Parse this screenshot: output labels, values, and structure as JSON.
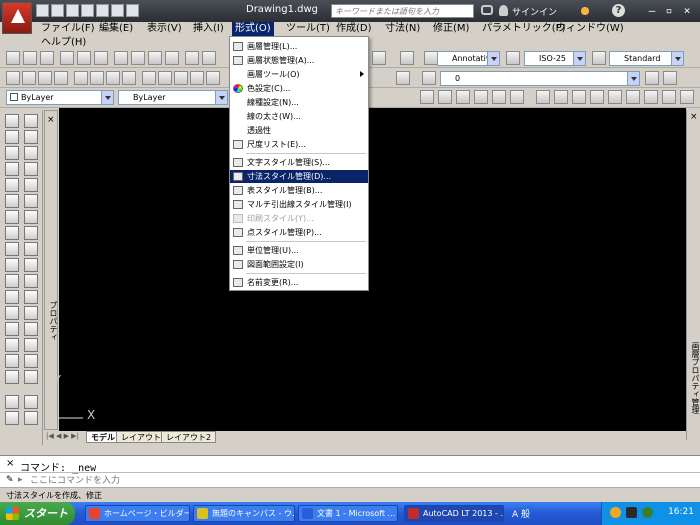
{
  "title": "Drawing1.dwg",
  "search": {
    "placeholder": "キーワードまたは語句を入力"
  },
  "account": {
    "signin_label": "サインイン"
  },
  "menubar": {
    "items": [
      {
        "label": "ファイル(F)"
      },
      {
        "label": "編集(E)"
      },
      {
        "label": "表示(V)"
      },
      {
        "label": "挿入(I)"
      },
      {
        "label": "形式(O)"
      },
      {
        "label": "ツール(T)"
      },
      {
        "label": "作成(D)"
      },
      {
        "label": "寸法(N)"
      },
      {
        "label": "修正(M)"
      },
      {
        "label": "パラメトリック(P)"
      },
      {
        "label": "ウィンドウ(W)"
      },
      {
        "label": "ヘルプ(H)"
      }
    ],
    "active_index": 4
  },
  "format_menu": {
    "items": [
      {
        "label": "画層管理(L)...",
        "icon": "layer-manager-icon"
      },
      {
        "label": "画層状態管理(A)...",
        "icon": "layer-state-icon"
      },
      {
        "label": "画層ツール(O)",
        "icon": "",
        "submenu": true
      },
      {
        "label": "色設定(C)...",
        "icon": "color-wheel-icon"
      },
      {
        "label": "線種設定(N)...",
        "icon": ""
      },
      {
        "label": "線の太さ(W)...",
        "icon": ""
      },
      {
        "label": "透過性",
        "icon": ""
      },
      {
        "label": "尺度リスト(E)...",
        "icon": "scale-list-icon"
      },
      {
        "label": "文字スタイル管理(S)...",
        "icon": "text-style-icon"
      },
      {
        "label": "寸法スタイル管理(D)...",
        "icon": "dimension-style-icon",
        "highlighted": true
      },
      {
        "label": "表スタイル管理(B)...",
        "icon": "table-style-icon"
      },
      {
        "label": "マルチ引出線スタイル管理(I)",
        "icon": "multileader-style-icon"
      },
      {
        "label": "印刷スタイル(Y)...",
        "icon": "plot-style-icon",
        "disabled": true
      },
      {
        "label": "点スタイル管理(P)...",
        "icon": "point-style-icon"
      },
      {
        "label": "単位管理(U)...",
        "icon": "units-icon"
      },
      {
        "label": "図面範囲設定(I)",
        "icon": "limits-icon"
      },
      {
        "label": "名前変更(R)...",
        "icon": "rename-icon"
      }
    ]
  },
  "toolbar": {
    "annotation_scale": "Annotative",
    "dim_style": "ISO-25",
    "text_style": "Standard",
    "layer": "0",
    "color": "ByLayer",
    "linetype": "ByLayer"
  },
  "side_panels": {
    "properties": "プロパティ",
    "layer_properties": "画層プロパティ管理"
  },
  "layout_tabs": [
    {
      "label": "モデル",
      "active": true
    },
    {
      "label": "レイアウト1"
    },
    {
      "label": "レイアウト2"
    }
  ],
  "axes": {
    "x": "X",
    "y": "Y"
  },
  "command_line": {
    "history_label": "コマンド:",
    "history_value": "_new",
    "placeholder": "ここにコマンドを入力"
  },
  "status_text": "寸法スタイルを作成、修正",
  "taskbar": {
    "start_label": "スタート",
    "tasks": [
      {
        "label": "ホームページ・ビルダー...",
        "color": "#e8442b"
      },
      {
        "label": "無題のキャンバス - ウ...",
        "color": "#d9c024"
      },
      {
        "label": "文書 1 - Microsoft ...",
        "color": "#2b5fd9"
      },
      {
        "label": "AutoCAD LT 2013 - ...",
        "color": "#c62b2b",
        "active": true
      }
    ],
    "ime_text": "A 般",
    "clock": "16:21"
  },
  "colors": {
    "accent": "#0a246a",
    "titlebar": "#2b2e33",
    "canvas": "#000000"
  }
}
